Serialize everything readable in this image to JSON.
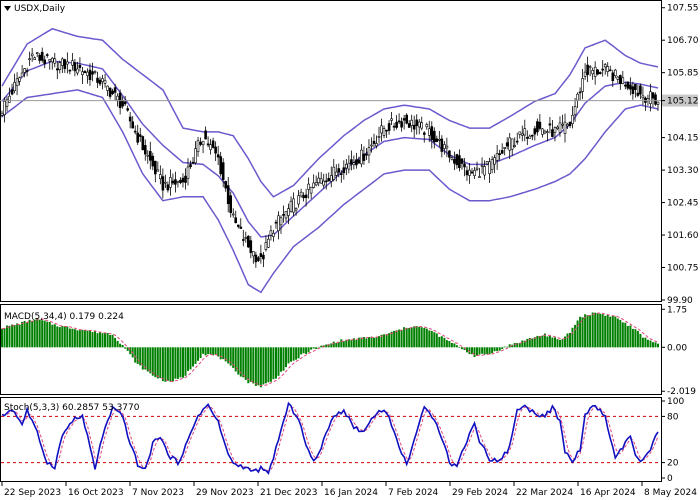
{
  "colors": {
    "candle": "#000000",
    "bollinger": "#6a5acd",
    "macd_hist": "#008000",
    "macd_signal": "#e0457b",
    "stoch_main": "#1010c0",
    "stoch_signal": "#e0457b",
    "price_tag_bg": "#c8c8c8",
    "level_line": "#d00000"
  },
  "chart_data": [
    {
      "type": "candlestick",
      "title": "USDX,Daily",
      "current_price_label": "105.12",
      "y_ticks": [
        "107.55",
        "106.70",
        "105.85",
        "105.12",
        "104.15",
        "103.30",
        "102.45",
        "101.60",
        "100.75",
        "99.90"
      ],
      "y_tick_values": [
        107.55,
        106.7,
        105.85,
        105.12,
        104.15,
        103.3,
        102.45,
        101.6,
        100.75,
        99.9
      ],
      "ylim": [
        99.9,
        107.7
      ],
      "x_ticks": [
        "22 Sep 2023",
        "16 Oct 2023",
        "7 Nov 2023",
        "29 Nov 2023",
        "21 Dec 2023",
        "16 Jan 2024",
        "7 Feb 2024",
        "29 Feb 2024",
        "22 Mar 2024",
        "16 Apr 2024",
        "8 May 2024"
      ],
      "close_keypoints": [
        [
          0,
          104.9
        ],
        [
          12,
          106.3
        ],
        [
          20,
          106.1
        ],
        [
          30,
          106.0
        ],
        [
          40,
          105.6
        ],
        [
          48,
          105.0
        ],
        [
          56,
          103.9
        ],
        [
          64,
          102.9
        ],
        [
          72,
          103.0
        ],
        [
          80,
          104.2
        ],
        [
          86,
          103.6
        ],
        [
          92,
          102.0
        ],
        [
          98,
          101.3
        ],
        [
          103,
          100.9
        ],
        [
          108,
          101.8
        ],
        [
          116,
          102.4
        ],
        [
          126,
          103.0
        ],
        [
          136,
          103.4
        ],
        [
          144,
          103.7
        ],
        [
          152,
          104.4
        ],
        [
          160,
          104.6
        ],
        [
          170,
          104.3
        ],
        [
          178,
          103.7
        ],
        [
          186,
          103.2
        ],
        [
          194,
          103.4
        ],
        [
          202,
          104.0
        ],
        [
          212,
          104.4
        ],
        [
          220,
          104.3
        ],
        [
          226,
          104.5
        ],
        [
          232,
          105.9
        ],
        [
          240,
          105.9
        ],
        [
          248,
          105.6
        ],
        [
          254,
          105.3
        ],
        [
          261,
          105.1
        ]
      ],
      "band_keypoints": [
        [
          0,
          105.5,
          104.7
        ],
        [
          10,
          106.6,
          105.2
        ],
        [
          20,
          107.0,
          105.3
        ],
        [
          30,
          106.8,
          105.4
        ],
        [
          40,
          106.7,
          105.2
        ],
        [
          48,
          106.2,
          104.3
        ],
        [
          56,
          105.8,
          103.2
        ],
        [
          64,
          105.4,
          102.5
        ],
        [
          72,
          104.4,
          102.6
        ],
        [
          80,
          104.3,
          102.6
        ],
        [
          86,
          104.3,
          102.0
        ],
        [
          92,
          104.2,
          101.2
        ],
        [
          98,
          103.6,
          100.3
        ],
        [
          103,
          103.0,
          100.1
        ],
        [
          108,
          102.6,
          100.6
        ],
        [
          116,
          102.9,
          101.3
        ],
        [
          126,
          103.6,
          101.8
        ],
        [
          136,
          104.2,
          102.4
        ],
        [
          144,
          104.6,
          102.8
        ],
        [
          152,
          104.9,
          103.2
        ],
        [
          160,
          105.0,
          103.3
        ],
        [
          170,
          104.9,
          103.3
        ],
        [
          178,
          104.6,
          102.8
        ],
        [
          186,
          104.4,
          102.5
        ],
        [
          194,
          104.4,
          102.5
        ],
        [
          202,
          104.7,
          102.6
        ],
        [
          212,
          105.1,
          102.8
        ],
        [
          220,
          105.3,
          103.0
        ],
        [
          226,
          105.8,
          103.2
        ],
        [
          232,
          106.5,
          103.6
        ],
        [
          240,
          106.7,
          104.3
        ],
        [
          248,
          106.3,
          104.9
        ],
        [
          254,
          106.1,
          105.0
        ],
        [
          261,
          106.0,
          104.9
        ]
      ]
    },
    {
      "type": "bar",
      "title": "MACD(5,34,4) 0.179 0.224",
      "y_ticks": [
        "1.75",
        "0.00",
        "-2.019"
      ],
      "y_tick_values": [
        1.75,
        0.0,
        -2.019
      ],
      "ylim": [
        -2.1,
        1.9
      ],
      "hist_keypoints": [
        [
          0,
          0.9
        ],
        [
          14,
          1.3
        ],
        [
          22,
          1.0
        ],
        [
          32,
          0.8
        ],
        [
          44,
          0.6
        ],
        [
          48,
          0.1
        ],
        [
          54,
          -0.8
        ],
        [
          60,
          -1.3
        ],
        [
          66,
          -1.6
        ],
        [
          72,
          -1.4
        ],
        [
          80,
          -0.3
        ],
        [
          86,
          -0.4
        ],
        [
          92,
          -1.0
        ],
        [
          98,
          -1.6
        ],
        [
          103,
          -1.8
        ],
        [
          108,
          -1.5
        ],
        [
          114,
          -0.8
        ],
        [
          120,
          -0.3
        ],
        [
          126,
          0.0
        ],
        [
          134,
          0.3
        ],
        [
          142,
          0.4
        ],
        [
          150,
          0.5
        ],
        [
          158,
          0.8
        ],
        [
          164,
          1.0
        ],
        [
          170,
          0.8
        ],
        [
          176,
          0.4
        ],
        [
          182,
          0.0
        ],
        [
          188,
          -0.4
        ],
        [
          194,
          -0.3
        ],
        [
          202,
          0.1
        ],
        [
          210,
          0.4
        ],
        [
          216,
          0.6
        ],
        [
          222,
          0.3
        ],
        [
          226,
          0.7
        ],
        [
          230,
          1.4
        ],
        [
          236,
          1.6
        ],
        [
          244,
          1.4
        ],
        [
          252,
          0.8
        ],
        [
          256,
          0.4
        ],
        [
          261,
          0.2
        ]
      ]
    },
    {
      "type": "line",
      "title": "Stoch(5,3,3) 60.2857 53.3770",
      "y_ticks": [
        "100",
        "80",
        "20",
        "0"
      ],
      "y_tick_values": [
        100,
        80,
        20,
        0
      ],
      "levels": [
        80,
        20
      ],
      "main_keypoints": [
        [
          0,
          80
        ],
        [
          4,
          90
        ],
        [
          8,
          70
        ],
        [
          10,
          88
        ],
        [
          14,
          58
        ],
        [
          18,
          20
        ],
        [
          21,
          15
        ],
        [
          24,
          55
        ],
        [
          28,
          75
        ],
        [
          32,
          80
        ],
        [
          35,
          40
        ],
        [
          37,
          12
        ],
        [
          40,
          55
        ],
        [
          44,
          90
        ],
        [
          48,
          80
        ],
        [
          51,
          45
        ],
        [
          54,
          18
        ],
        [
          57,
          10
        ],
        [
          60,
          45
        ],
        [
          63,
          55
        ],
        [
          66,
          30
        ],
        [
          70,
          20
        ],
        [
          74,
          48
        ],
        [
          78,
          82
        ],
        [
          82,
          95
        ],
        [
          86,
          72
        ],
        [
          89,
          40
        ],
        [
          92,
          18
        ],
        [
          96,
          15
        ],
        [
          100,
          8
        ],
        [
          103,
          12
        ],
        [
          106,
          5
        ],
        [
          110,
          50
        ],
        [
          114,
          95
        ],
        [
          118,
          78
        ],
        [
          121,
          42
        ],
        [
          124,
          20
        ],
        [
          128,
          48
        ],
        [
          132,
          82
        ],
        [
          136,
          88
        ],
        [
          140,
          66
        ],
        [
          144,
          60
        ],
        [
          148,
          82
        ],
        [
          152,
          90
        ],
        [
          155,
          70
        ],
        [
          158,
          40
        ],
        [
          161,
          18
        ],
        [
          164,
          50
        ],
        [
          168,
          90
        ],
        [
          172,
          78
        ],
        [
          176,
          45
        ],
        [
          178,
          20
        ],
        [
          181,
          15
        ],
        [
          184,
          42
        ],
        [
          188,
          72
        ],
        [
          190,
          48
        ],
        [
          194,
          25
        ],
        [
          198,
          22
        ],
        [
          202,
          40
        ],
        [
          205,
          90
        ],
        [
          208,
          92
        ],
        [
          212,
          85
        ],
        [
          216,
          80
        ],
        [
          219,
          92
        ],
        [
          222,
          72
        ],
        [
          224,
          35
        ],
        [
          227,
          20
        ],
        [
          230,
          38
        ],
        [
          232,
          82
        ],
        [
          236,
          94
        ],
        [
          240,
          80
        ],
        [
          242,
          52
        ],
        [
          244,
          24
        ],
        [
          247,
          40
        ],
        [
          250,
          55
        ],
        [
          252,
          30
        ],
        [
          254,
          20
        ],
        [
          257,
          30
        ],
        [
          261,
          60
        ]
      ]
    }
  ]
}
